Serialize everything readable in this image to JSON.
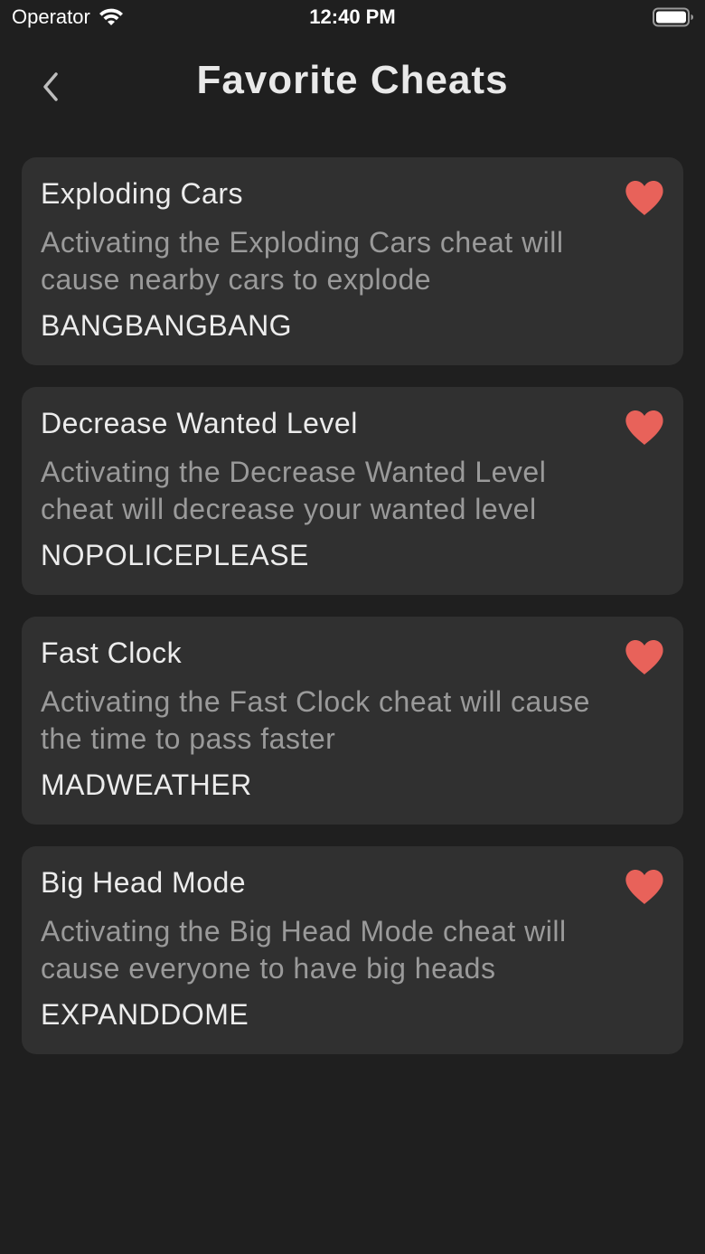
{
  "status_bar": {
    "carrier": "Operator",
    "time": "12:40 PM",
    "icons": [
      "wifi-icon",
      "battery-icon"
    ]
  },
  "nav": {
    "title": "Favorite Cheats",
    "back_icon": "chevron-left-icon"
  },
  "colors": {
    "background": "#1f1f1f",
    "card": "#303030",
    "heart": "#e8625a",
    "secondary_text": "#9a9a9a"
  },
  "cheats": [
    {
      "title": "Exploding Cars",
      "description": "Activating the Exploding Cars cheat will cause nearby cars to explode",
      "code": "BANGBANGBANG",
      "favorite_icon": "heart-icon"
    },
    {
      "title": "Decrease Wanted Level",
      "description": "Activating the Decrease Wanted Level cheat will decrease your wanted level",
      "code": "NOPOLICEPLEASE",
      "favorite_icon": "heart-icon"
    },
    {
      "title": "Fast Clock",
      "description": "Activating the Fast Clock cheat will cause the time to pass faster",
      "code": "MADWEATHER",
      "favorite_icon": "heart-icon"
    },
    {
      "title": "Big Head Mode",
      "description": "Activating the Big Head Mode cheat will cause everyone to have big heads",
      "code": "EXPANDDOME",
      "favorite_icon": "heart-icon"
    }
  ]
}
